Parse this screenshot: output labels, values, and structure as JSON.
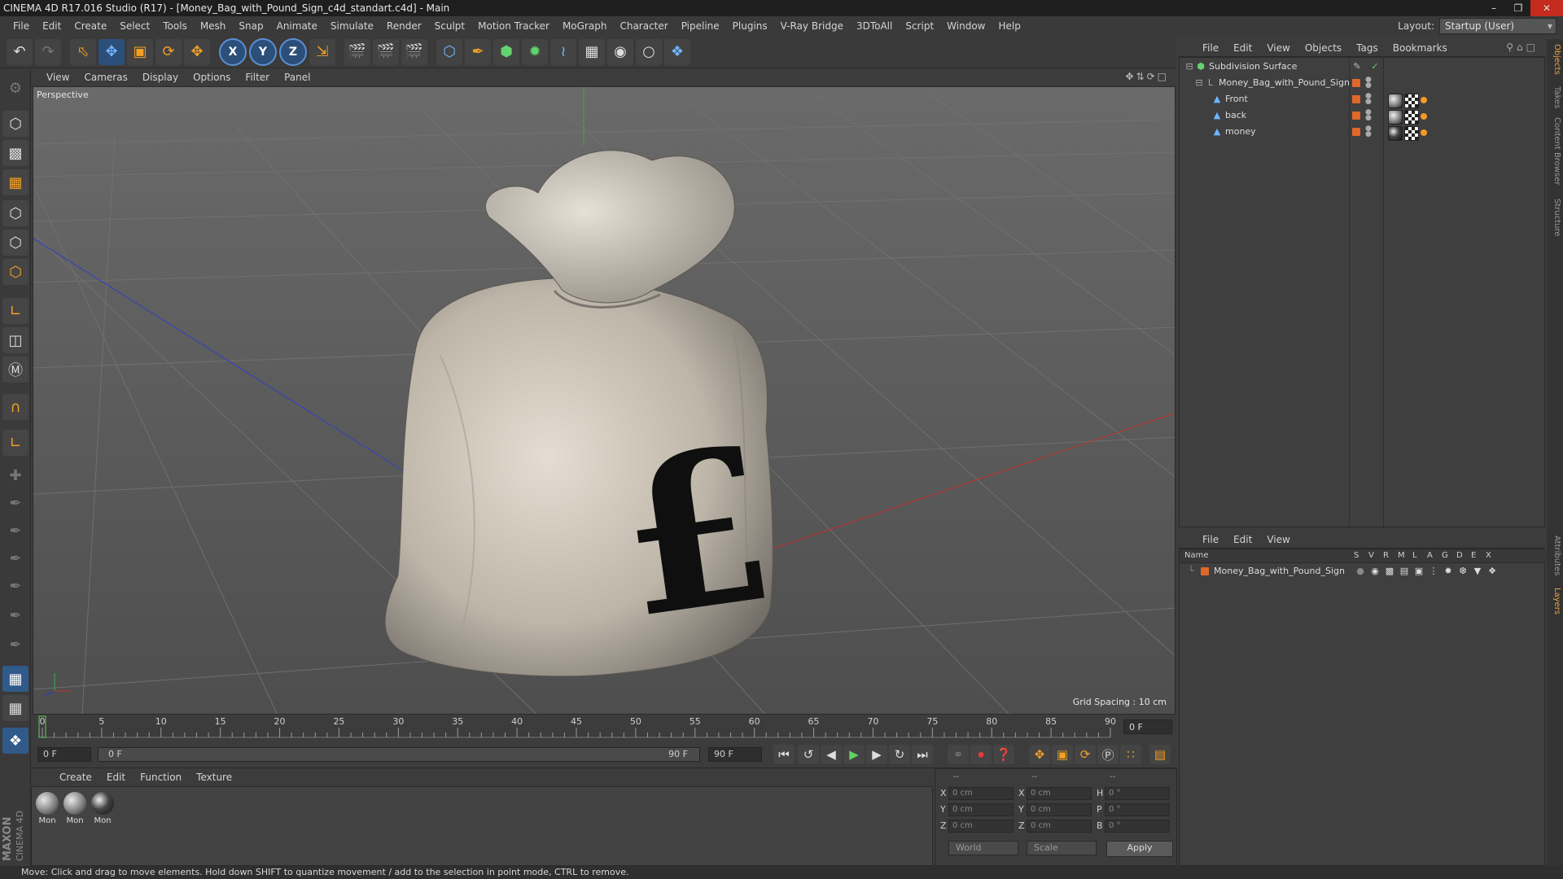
{
  "window": {
    "title": "CINEMA 4D R17.016 Studio (R17) - [Money_Bag_with_Pound_Sign_c4d_standart.c4d] - Main"
  },
  "menubar": {
    "items": [
      "File",
      "Edit",
      "Create",
      "Select",
      "Tools",
      "Mesh",
      "Snap",
      "Animate",
      "Simulate",
      "Render",
      "Sculpt",
      "Motion Tracker",
      "MoGraph",
      "Character",
      "Pipeline",
      "Plugins",
      "V-Ray Bridge",
      "3DToAll",
      "Script",
      "Window",
      "Help"
    ],
    "layout_label": "Layout:",
    "layout_value": "Startup (User)"
  },
  "toolbar": {
    "undo_icon": "undo-icon",
    "redo_icon": "redo-icon",
    "axis_x": "X",
    "axis_y": "Y",
    "axis_z": "Z"
  },
  "viewport": {
    "menus": [
      "View",
      "Cameras",
      "Display",
      "Options",
      "Filter",
      "Panel"
    ],
    "camera_label": "Perspective",
    "grid_spacing": "Grid Spacing : 10 cm"
  },
  "timeline": {
    "ticks": [
      "0",
      "5",
      "10",
      "15",
      "20",
      "25",
      "30",
      "35",
      "40",
      "45",
      "50",
      "55",
      "60",
      "65",
      "70",
      "75",
      "80",
      "85",
      "90"
    ],
    "current_frame": "0 F"
  },
  "transport": {
    "start_field": "0 F",
    "range_start": "0 F",
    "range_end": "90 F",
    "end_field": "90 F"
  },
  "materials": {
    "menus": [
      "Create",
      "Edit",
      "Function",
      "Texture"
    ],
    "items": [
      {
        "label": "Mon"
      },
      {
        "label": "Mon"
      },
      {
        "label": "Mon"
      }
    ]
  },
  "coords": {
    "headers": [
      "--",
      "--",
      "--"
    ],
    "rows": [
      {
        "a": "X",
        "av": "0 cm",
        "b": "X",
        "bv": "0 cm",
        "c": "H",
        "cv": "0 °"
      },
      {
        "a": "Y",
        "av": "0 cm",
        "b": "Y",
        "bv": "0 cm",
        "c": "P",
        "cv": "0 °"
      },
      {
        "a": "Z",
        "av": "0 cm",
        "b": "Z",
        "bv": "0 cm",
        "c": "B",
        "cv": "0 °"
      }
    ],
    "space": "World",
    "mode": "Scale",
    "apply": "Apply"
  },
  "object_manager": {
    "menus": [
      "File",
      "Edit",
      "View",
      "Objects",
      "Tags",
      "Bookmarks"
    ],
    "objects": [
      {
        "name": "Subdivision Surface"
      },
      {
        "name": "Money_Bag_with_Pound_Sign"
      },
      {
        "name": "Front"
      },
      {
        "name": "back"
      },
      {
        "name": "money"
      }
    ]
  },
  "layer_manager": {
    "menus": [
      "File",
      "Edit",
      "View"
    ],
    "columns": [
      "Name",
      "S",
      "V",
      "R",
      "M",
      "L",
      "A",
      "G",
      "D",
      "E",
      "X"
    ],
    "layers": [
      {
        "name": "Money_Bag_with_Pound_Sign"
      }
    ]
  },
  "right_tabs": [
    "Objects",
    "Takes",
    "Content Browser",
    "Structure",
    "Attributes",
    "Layers"
  ],
  "status": {
    "text": "Move: Click and drag to move elements. Hold down SHIFT to quantize movement / add to the selection in point mode, CTRL to remove."
  },
  "logo": {
    "line1": "MAXON",
    "line2": "CINEMA 4D"
  },
  "colors": {
    "accent_orange": "#f3a025",
    "layer_color": "#e0682a",
    "axis_blue": "#5b8fd0"
  }
}
